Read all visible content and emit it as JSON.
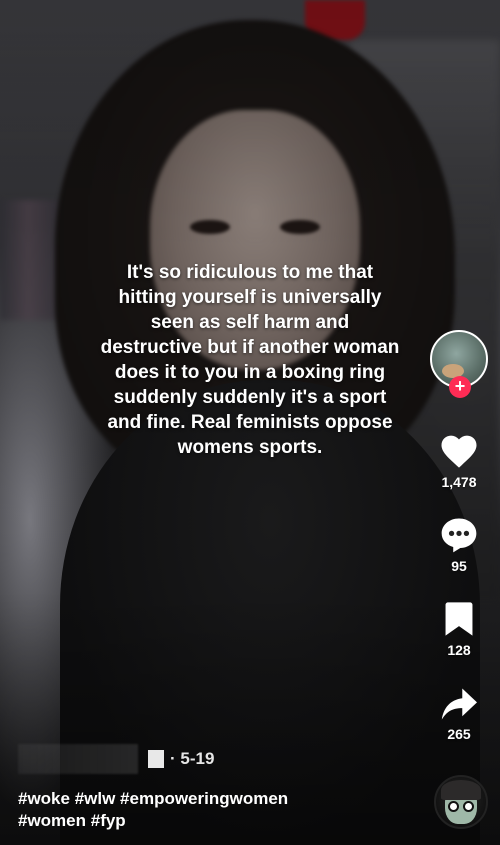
{
  "overlay": {
    "text": "It's so ridiculous to me that hitting yourself is universally seen as self harm and destructive but if another woman does it to you in a boxing ring suddenly suddenly it's a sport and fine. Real feminists oppose womens sports."
  },
  "rail": {
    "likes": "1,478",
    "comments": "95",
    "saves": "128",
    "shares": "265",
    "follow_symbol": "+"
  },
  "meta": {
    "date": "· 5-19"
  },
  "caption": {
    "line1": "#woke #wlw #empoweringwomen",
    "line2": "#women #fyp"
  },
  "icons": {
    "like": "heart-icon",
    "comment": "comment-bubble-icon",
    "save": "bookmark-icon",
    "share": "share-arrow-icon"
  },
  "colors": {
    "accent": "#fe2c55",
    "text": "#ffffff"
  }
}
